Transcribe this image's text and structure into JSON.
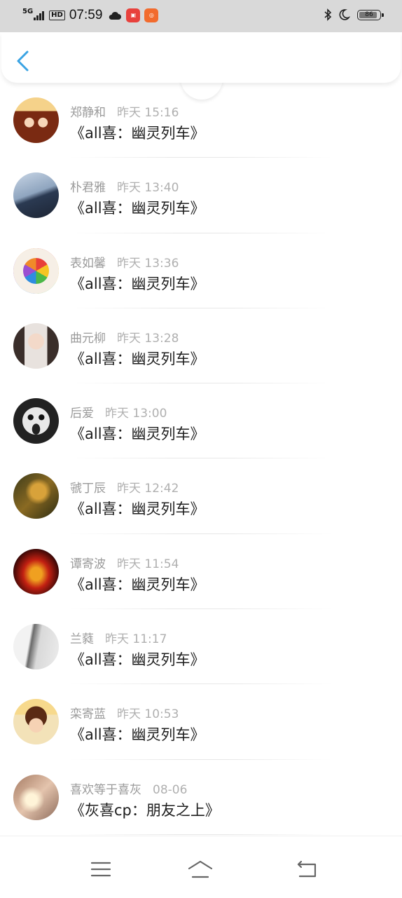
{
  "status_bar": {
    "network": "5G",
    "hd": "HD",
    "time": "07:59",
    "battery": "86"
  },
  "header": {
    "back_icon": "chevron-left-icon",
    "accent": "#3aa3e3"
  },
  "items": [
    {
      "name": "郑静和",
      "time": "昨天 15:16",
      "title": "《all喜：幽灵列车》"
    },
    {
      "name": "朴君雅",
      "time": "昨天 13:40",
      "title": "《all喜：幽灵列车》"
    },
    {
      "name": "表如馨",
      "time": "昨天 13:36",
      "title": "《all喜：幽灵列车》"
    },
    {
      "name": "曲元柳",
      "time": "昨天 13:28",
      "title": "《all喜：幽灵列车》"
    },
    {
      "name": "后爱",
      "time": "昨天 13:00",
      "title": "《all喜：幽灵列车》"
    },
    {
      "name": "虢丁辰",
      "time": "昨天 12:42",
      "title": "《all喜：幽灵列车》"
    },
    {
      "name": "谭寄波",
      "time": "昨天 11:54",
      "title": "《all喜：幽灵列车》"
    },
    {
      "name": "兰蕤",
      "time": "昨天 11:17",
      "title": "《all喜：幽灵列车》"
    },
    {
      "name": "栾寄蓝",
      "time": "昨天 10:53",
      "title": "《all喜：幽灵列车》"
    },
    {
      "name": "喜欢等于喜灰",
      "time": "08-06",
      "title": "《灰喜cp：朋友之上》"
    }
  ],
  "navbar": {
    "menu_icon": "menu-icon",
    "home_icon": "home-icon",
    "back_icon": "back-icon"
  }
}
